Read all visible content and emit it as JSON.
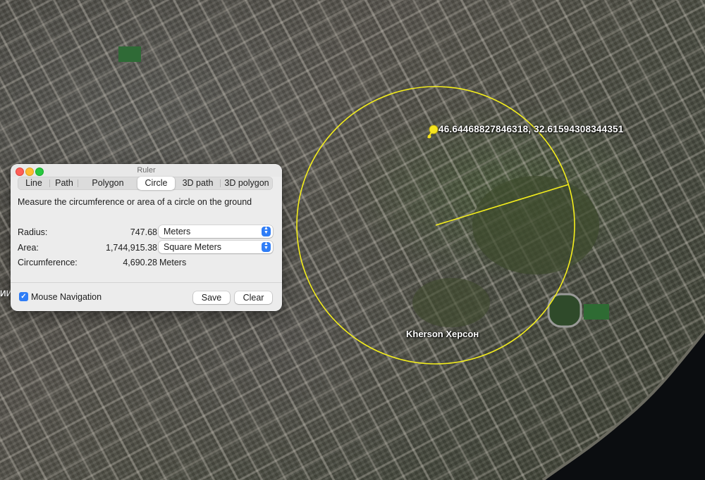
{
  "map": {
    "pin_coordinates": "46.64468827846318, 32.61594308344351",
    "city_label": "Kherson Херсон",
    "edge_label": "ИИ",
    "measure_color": "#f4ee1c"
  },
  "ruler": {
    "title": "Ruler",
    "tabs": [
      {
        "label": "Line",
        "active": false
      },
      {
        "label": "Path",
        "active": false
      },
      {
        "label": "Polygon",
        "active": false
      },
      {
        "label": "Circle",
        "active": true
      },
      {
        "label": "3D path",
        "active": false
      },
      {
        "label": "3D polygon",
        "active": false
      }
    ],
    "description": "Measure the circumference or area of a circle on the ground",
    "radius": {
      "label": "Radius:",
      "value": "747.68",
      "unit": "Meters"
    },
    "area": {
      "label": "Area:",
      "value": "1,744,915.38",
      "unit": "Square Meters"
    },
    "circumference": {
      "label": "Circumference:",
      "value": "4,690.28",
      "unit": "Meters"
    },
    "mouse_navigation": {
      "label": "Mouse Navigation",
      "checked": true
    },
    "save_label": "Save",
    "clear_label": "Clear"
  }
}
